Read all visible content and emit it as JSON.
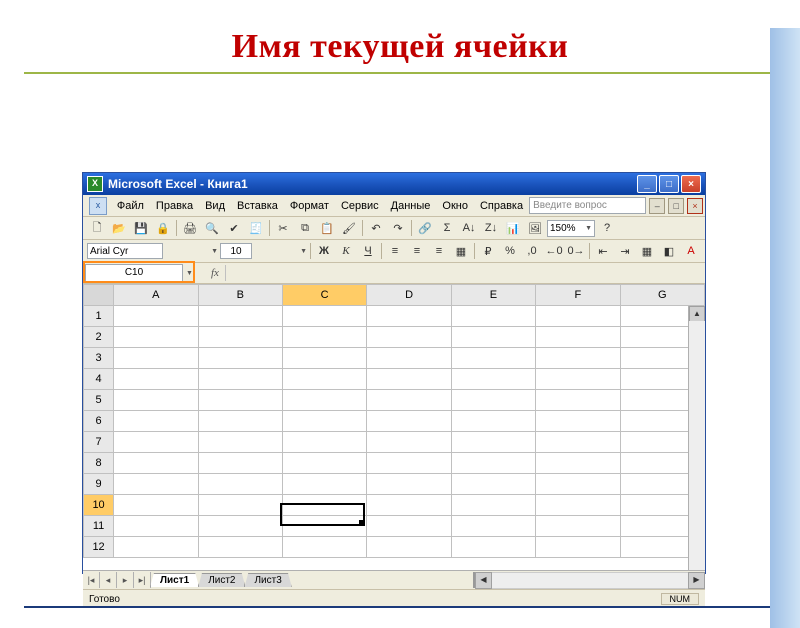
{
  "slide_title": "Имя текущей ячейки",
  "titlebar": {
    "text": "Microsoft Excel - Книга1"
  },
  "window_buttons": {
    "min": "_",
    "max": "□",
    "close": "×"
  },
  "menu": {
    "items": [
      "Файл",
      "Правка",
      "Вид",
      "Вставка",
      "Формат",
      "Сервис",
      "Данные",
      "Окно",
      "Справка"
    ],
    "ask_placeholder": "Введите вопрос",
    "sub_min": "–",
    "sub_max": "□",
    "sub_close": "×"
  },
  "toolbar_std": {
    "new": "🗋",
    "open": "📂",
    "save": "💾",
    "perm": "🔒",
    "print": "🖨",
    "preview": "🔍",
    "spell": "✔",
    "research": "🧾",
    "cut": "✂",
    "copy": "⧉",
    "paste": "📋",
    "fmtpaint": "🖌",
    "undo": "↶",
    "redo": "↷",
    "link": "🔗",
    "sum": "Σ",
    "sort_az": "A↓",
    "sort_za": "Z↓",
    "chart": "📊",
    "drawing": "🖼",
    "zoom_value": "150%",
    "help": "?"
  },
  "toolbar_fmt": {
    "font": "Arial Cyr",
    "size": "10",
    "bold": "Ж",
    "italic": "К",
    "underline": "Ч",
    "left": "≡",
    "center": "≡",
    "right": "≡",
    "merge": "▦",
    "currency": "₽",
    "percent": "%",
    "comma": ",0",
    "dec_inc": "←0",
    "dec_dec": "0→",
    "indent_dec": "⇤",
    "indent_inc": "⇥",
    "borders": "▦",
    "fill": "◧",
    "font_color": "A"
  },
  "formula_bar": {
    "name_box": "C10",
    "fx": "fx"
  },
  "columns": [
    "A",
    "B",
    "C",
    "D",
    "E",
    "F",
    "G"
  ],
  "rows": [
    "1",
    "2",
    "3",
    "4",
    "5",
    "6",
    "7",
    "8",
    "9",
    "10",
    "11",
    "12"
  ],
  "selected": {
    "col": "C",
    "row": "10"
  },
  "sheet_tabs": {
    "nav": [
      "|◂",
      "◂",
      "▸",
      "▸|"
    ],
    "tabs": [
      "Лист1",
      "Лист2",
      "Лист3"
    ],
    "active": 0
  },
  "statusbar": {
    "ready": "Готово",
    "num": "NUM"
  }
}
